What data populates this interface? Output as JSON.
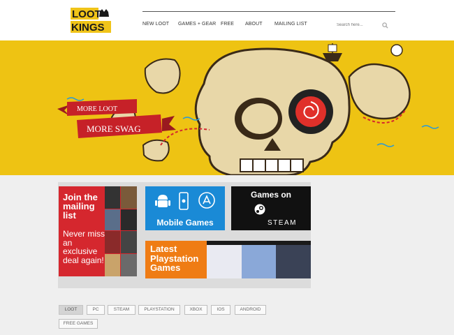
{
  "header": {
    "logo_line1": "LOOT",
    "logo_line2": "KINGS",
    "nav": [
      "NEW LOOT",
      "GAMES + GEAR",
      "FREE",
      "ABOUT",
      "MAILING LIST"
    ],
    "search_placeholder": "Search here..."
  },
  "banner": {
    "ribbon1": "MORE LOOT",
    "ribbon2": "MORE SWAG"
  },
  "tiles": {
    "mailing_title": "Join the mailing list",
    "mailing_text": "Never miss an exclusive deal again!",
    "mobile_label": "Mobile Games",
    "steam_title": "Games on",
    "steam_word": "STEAM",
    "ps_label": "Latest Playstation Games"
  },
  "tags": [
    "LOOT",
    "PC",
    "STEAM",
    "PLAYSTATION",
    "XBOX",
    "IOS",
    "ANDROID",
    "FREE GAMES"
  ],
  "colors": {
    "banner": "#eec313",
    "mailing": "#d5272e",
    "mobile": "#1a8ad6",
    "steam": "#111111",
    "playstation": "#ef7c14"
  }
}
